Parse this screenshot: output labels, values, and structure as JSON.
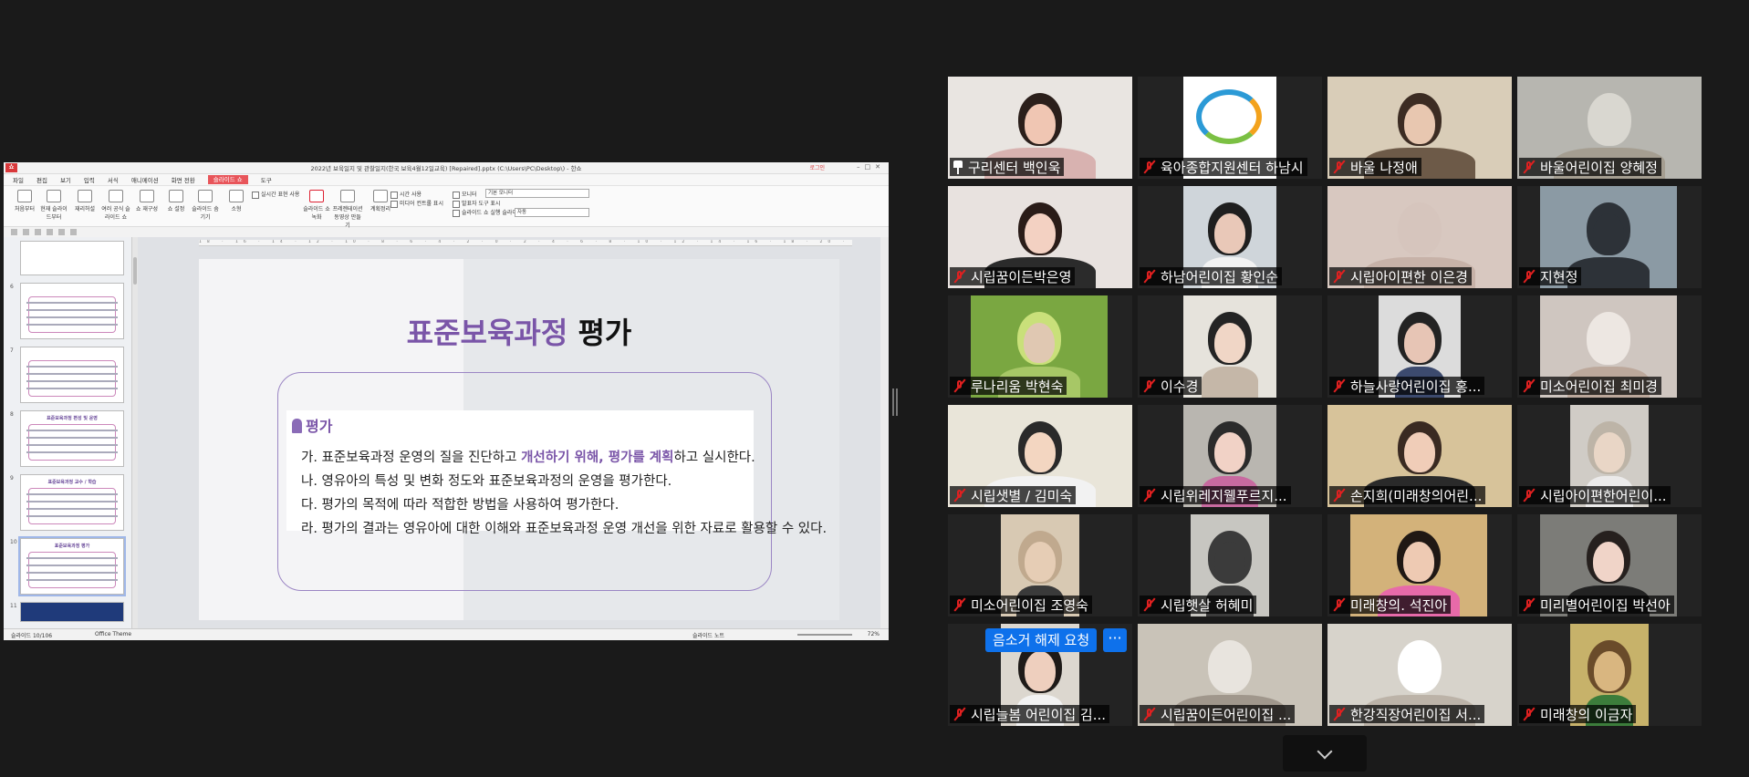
{
  "share": {
    "window_title": "2022년 보육일지 및 관찰일지(한국 보육4월12일교육) [Repaired].pptx (C:\\Users\\PC\\Desktop\\) - 한쇼",
    "app_logo": "쇼",
    "login": "로그인",
    "menus": [
      "파일",
      "편집",
      "보기",
      "입력",
      "서식",
      "애니메이션",
      "화면 전환",
      "슬라이드 쇼",
      "도구"
    ],
    "active_menu": "슬라이드 쇼",
    "ribbon": {
      "buttons": [
        "처음부터",
        "현재 슬라이드부터",
        "재리허설",
        "여러 공식 슬라이드 쇼",
        "쇼 재구성",
        "쇼 설정",
        "슬라이드 숨기기",
        "소형",
        "슬라이드 쇼 녹화",
        "프레젠테이션 동영상 만들기",
        "계획정리"
      ],
      "checks": [
        "실시간 표현 사용",
        "시간 사용",
        "미디어 컨트롤 표시",
        "발표자 도구 표시",
        "모니터",
        "슬라이드 쇼 실행 슬라이드"
      ],
      "monitor_select": "기본 모니터",
      "auto_select": "자동"
    },
    "thumbs": [
      {
        "num": "",
        "title": ""
      },
      {
        "num": "6",
        "title": ""
      },
      {
        "num": "7",
        "title": ""
      },
      {
        "num": "8",
        "title": "표준보육과정 편성 및 운영"
      },
      {
        "num": "9",
        "title": "표준보육과정 교수 / 학습"
      },
      {
        "num": "10",
        "title": "표준보육과정 평가"
      },
      {
        "num": "11",
        "title": ""
      }
    ],
    "ruler": "18 · 16 · 14 · 12 · 10 · 8 · 6 · 4 · 2 · 0 · 2 · 4 · 6 · 8 · 10 · 12 · 14 · 16 · 18 · 20 · 22 · 24 · 25",
    "slide": {
      "title_highlight": "표준보육과정",
      "title_rest": " 평가",
      "eval_head": "평가",
      "lines": [
        {
          "pre": "가. 표준보육과정 운영의 질을 진단하고 ",
          "hl": "개선하기 위해, 평가를 계획",
          "post": "하고 실시한다."
        },
        {
          "pre": "나. 영유아의 특성 및 변화 정도와 표준보육과정의 운영을 평가한다.",
          "hl": "",
          "post": ""
        },
        {
          "pre": "다. 평가의 목적에 따라 적합한 방법을 사용하여 평가한다.",
          "hl": "",
          "post": ""
        },
        {
          "pre": "라. 평가의 결과는 영유아에 대한 이해와 표준보육과정 운영 개선을 위한 자료로 활용할 수 있다.",
          "hl": "",
          "post": ""
        }
      ]
    },
    "status": {
      "slide_counter": "슬라이드 10/106",
      "theme": "Office Theme",
      "mode": "슬라이드 노트",
      "zoom": "72%"
    }
  },
  "participants": [
    {
      "name": "구리센터 백인욱",
      "pinned": true,
      "muted": false
    },
    {
      "name": "육아종합지원센터 하남시",
      "pinned": false,
      "muted": true
    },
    {
      "name": "바울 나정애",
      "pinned": false,
      "muted": true
    },
    {
      "name": "바울어린이집 양혜정",
      "pinned": false,
      "muted": true
    },
    {
      "name": "시립꿈이든박은영",
      "pinned": false,
      "muted": true
    },
    {
      "name": "하남어린이집 황인순",
      "pinned": false,
      "muted": true
    },
    {
      "name": "시립아이편한 이은경",
      "pinned": false,
      "muted": true
    },
    {
      "name": "지현정",
      "pinned": false,
      "muted": true
    },
    {
      "name": "루나리움 박현숙",
      "pinned": false,
      "muted": true
    },
    {
      "name": "이수경",
      "pinned": false,
      "muted": true
    },
    {
      "name": "하늘사랑어린이집 홍...",
      "pinned": false,
      "muted": true
    },
    {
      "name": "미소어린이집 최미경",
      "pinned": false,
      "muted": true
    },
    {
      "name": "시립샛별 / 김미숙",
      "pinned": false,
      "muted": true
    },
    {
      "name": "시립위레지웰푸르지...",
      "pinned": false,
      "muted": true
    },
    {
      "name": "손지희(미래창의어린...",
      "pinned": false,
      "muted": true
    },
    {
      "name": "시립아이편한어린이...",
      "pinned": false,
      "muted": true
    },
    {
      "name": "미소어린이집 조영숙",
      "pinned": false,
      "muted": true
    },
    {
      "name": "시립햇살 허혜미",
      "pinned": false,
      "muted": true
    },
    {
      "name": "미래창의. 석진아",
      "pinned": false,
      "muted": true
    },
    {
      "name": "미리별어린이집 박선아",
      "pinned": false,
      "muted": true
    },
    {
      "name": "시립늘봄 어린이집 김...",
      "pinned": false,
      "muted": true
    },
    {
      "name": "시립꿈이든어린이집 ...",
      "pinned": false,
      "muted": true
    },
    {
      "name": "한강직장어린이집 서...",
      "pinned": false,
      "muted": true
    },
    {
      "name": "미래창의 이금자",
      "pinned": false,
      "muted": true
    }
  ],
  "controls": {
    "unmute_request": "음소거 해제 요청",
    "more": "···"
  },
  "colors": {
    "speaking_outline": "#c9e86c",
    "accent_purple": "#7a55a8",
    "zoom_blue": "#0e71eb",
    "mic_off_red": "#e02020"
  }
}
